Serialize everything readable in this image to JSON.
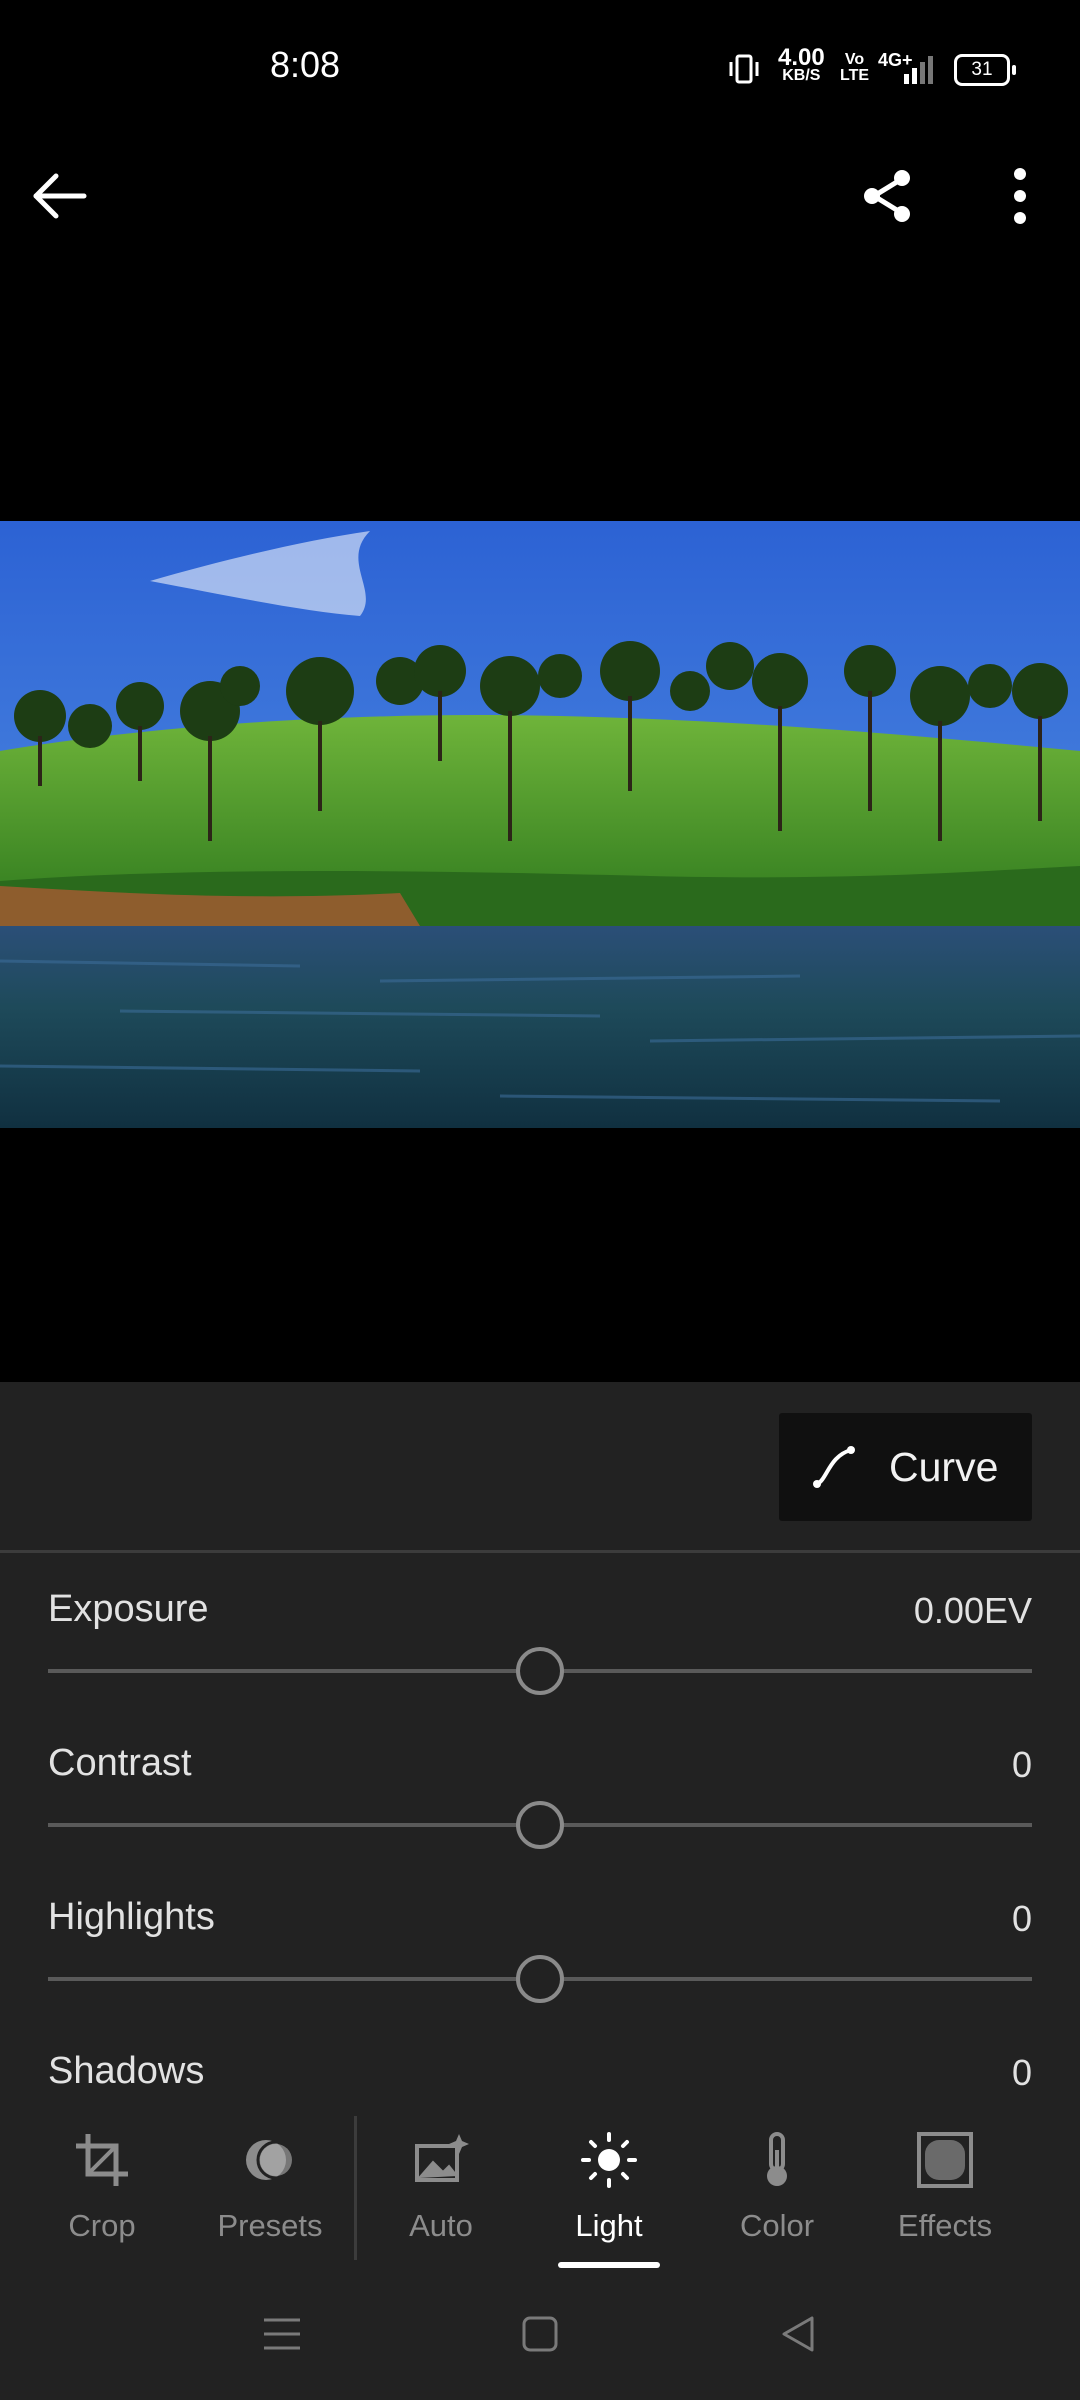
{
  "status_bar": {
    "time": "8:08",
    "net_speed": "4.00",
    "net_unit": "KB/S",
    "volte_top": "Vo",
    "volte_bottom": "LTE",
    "signal": "4G+",
    "battery": "31"
  },
  "top_bar": {
    "back_icon": "arrow-left-icon",
    "share_icon": "share-icon",
    "more_icon": "more-vertical-icon"
  },
  "photo": {
    "subject": "tea-plantation-landscape"
  },
  "panel": {
    "curve_button": "Curve",
    "adjustments": [
      {
        "label": "Exposure",
        "value": "0.00EV",
        "level": 0.5
      },
      {
        "label": "Contrast",
        "value": "0",
        "level": 0.5
      },
      {
        "label": "Highlights",
        "value": "0",
        "level": 0.5
      },
      {
        "label": "Shadows",
        "value": "0",
        "level": 0.5
      }
    ]
  },
  "tools": {
    "items": [
      {
        "label": "Crop",
        "icon": "crop-icon"
      },
      {
        "label": "Presets",
        "icon": "presets-icon"
      },
      {
        "label": "Auto",
        "icon": "auto-icon"
      },
      {
        "label": "Light",
        "icon": "sun-icon",
        "active": true
      },
      {
        "label": "Color",
        "icon": "thermometer-icon"
      },
      {
        "label": "Effects",
        "icon": "effects-icon"
      }
    ]
  },
  "nav_bar": {
    "menu_icon": "menu-icon",
    "home_icon": "home-square-icon",
    "back_icon": "back-triangle-icon"
  },
  "colors": {
    "panel_bg": "#222222",
    "active_text": "#ffffff",
    "inactive_text": "#8c8c8c",
    "slider_thumb": "#8a8a8a"
  }
}
